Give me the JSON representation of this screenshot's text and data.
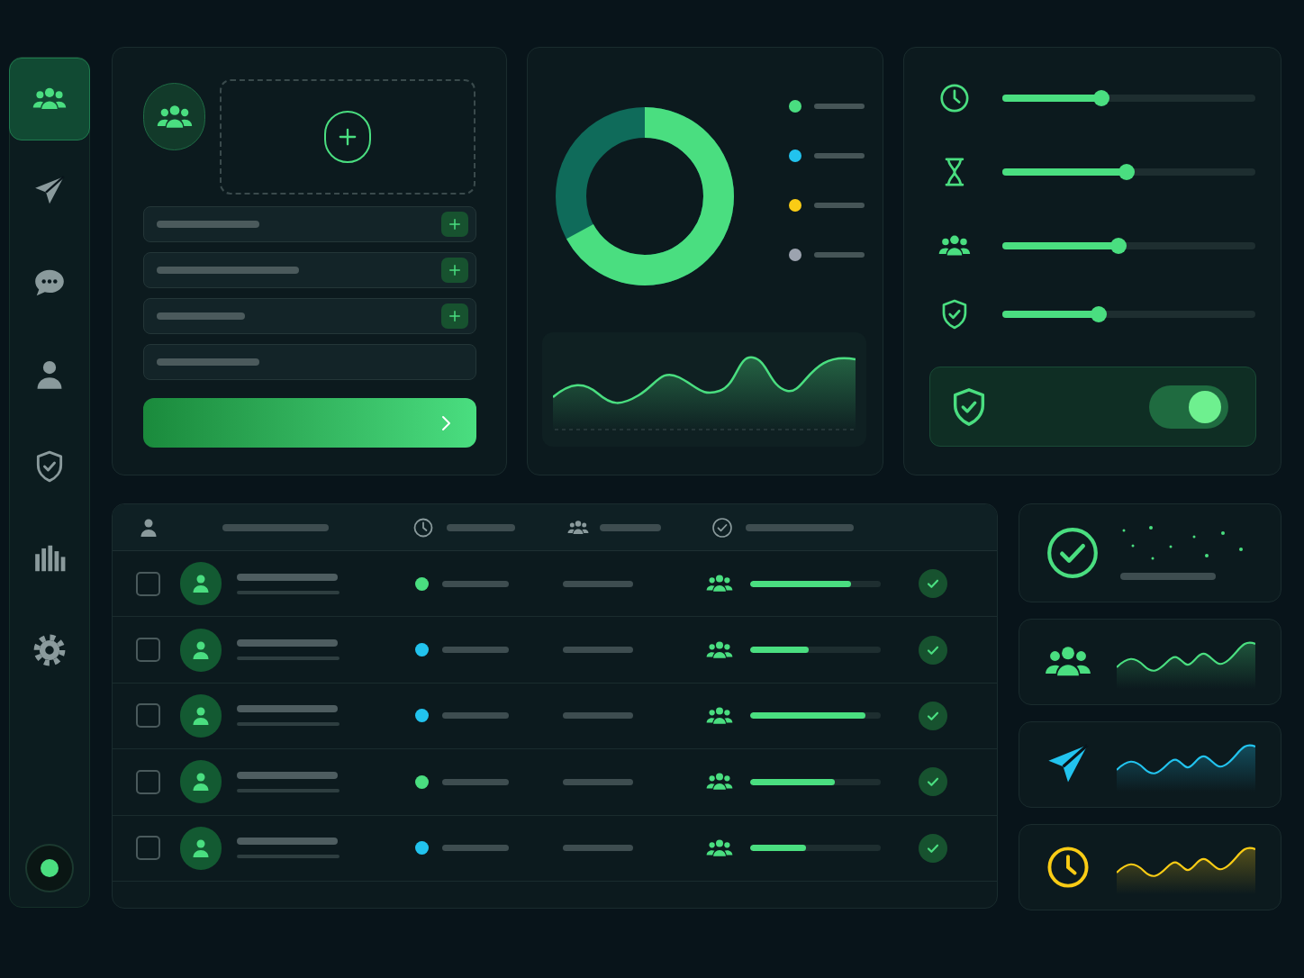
{
  "sidebar": {
    "items": [
      {
        "kind": "users",
        "selected": true
      },
      {
        "kind": "send",
        "selected": false
      },
      {
        "kind": "chat",
        "selected": false
      },
      {
        "kind": "user",
        "selected": false
      },
      {
        "kind": "shield",
        "selected": false
      },
      {
        "kind": "chart",
        "selected": false
      },
      {
        "kind": "gear",
        "selected": false
      }
    ],
    "status": {
      "on": true
    }
  },
  "form": {
    "fields": [
      {
        "kind": "add"
      },
      {
        "kind": "add"
      },
      {
        "kind": "add"
      },
      {
        "kind": "plain"
      }
    ]
  },
  "overview": {
    "legend": [
      {
        "color": "#4ade80"
      },
      {
        "color": "#22c3ee"
      },
      {
        "color": "#facc15"
      },
      {
        "color": "#9ca3af"
      }
    ]
  },
  "controls": {
    "sliders": [
      {
        "kind": "clock",
        "level": 0.39
      },
      {
        "kind": "hourglass",
        "level": 0.49
      },
      {
        "kind": "users",
        "level": 0.46
      },
      {
        "kind": "shield",
        "level": 0.38
      }
    ],
    "toggle": {
      "on": true
    }
  },
  "table": {
    "columns": [
      {
        "kind": "user"
      },
      {
        "kind": "clock"
      },
      {
        "kind": "users"
      },
      {
        "kind": "check"
      }
    ],
    "rows": [
      {
        "checked": false,
        "color": "#4ade80",
        "level": 0.77
      },
      {
        "checked": false,
        "color": "#22c3ee",
        "level": 0.45
      },
      {
        "checked": false,
        "color": "#22c3ee",
        "level": 0.88
      },
      {
        "checked": false,
        "color": "#4ade80",
        "level": 0.65
      },
      {
        "checked": false,
        "color": "#22c3ee",
        "level": 0.43
      }
    ]
  },
  "cards": [
    {
      "kind": "check",
      "color": "#4ade80"
    },
    {
      "kind": "users",
      "color": "#4ade80"
    },
    {
      "kind": "send",
      "color": "#22c3ee"
    },
    {
      "kind": "clock",
      "color": "#facc15"
    }
  ]
}
